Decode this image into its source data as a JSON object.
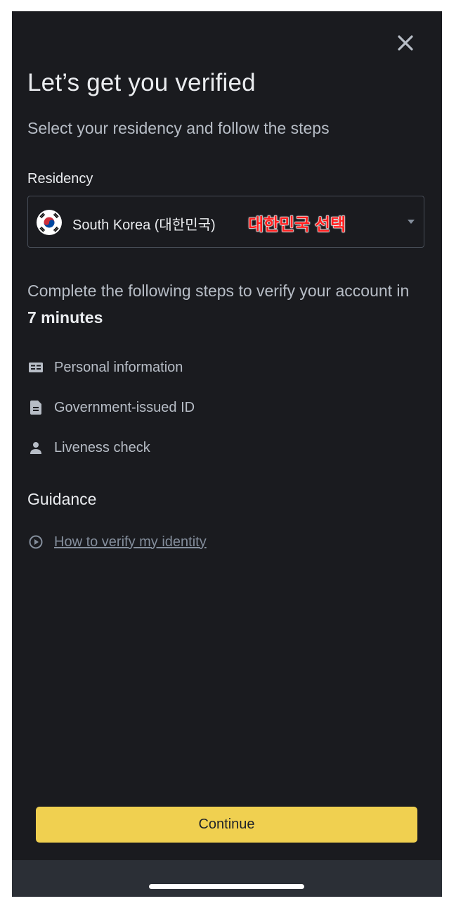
{
  "header": {
    "title": "Let’s get you verified",
    "subtitle": "Select your residency and follow the steps",
    "close_icon": "close-icon"
  },
  "residency": {
    "label": "Residency",
    "selected_value": "South Korea (대한민국)",
    "flag_icon": "south-korea-flag-icon",
    "annotation": "대한민국 선택",
    "annotation_color": "#ff1e1e"
  },
  "intro": {
    "text_prefix": "Complete the following steps to verify your account in ",
    "duration": "7 minutes"
  },
  "steps": [
    {
      "label": "Personal information",
      "icon": "id-card-icon"
    },
    {
      "label": "Government-issued ID",
      "icon": "document-icon"
    },
    {
      "label": "Liveness check",
      "icon": "person-icon"
    }
  ],
  "guidance": {
    "heading": "Guidance",
    "link_label": "How to verify my identity",
    "link_icon": "play-circle-icon"
  },
  "actions": {
    "continue_label": "Continue"
  },
  "colors": {
    "background": "#1a1b1f",
    "accent": "#f0d050",
    "text_primary": "#eaecef",
    "text_secondary": "#b7bdc6"
  }
}
